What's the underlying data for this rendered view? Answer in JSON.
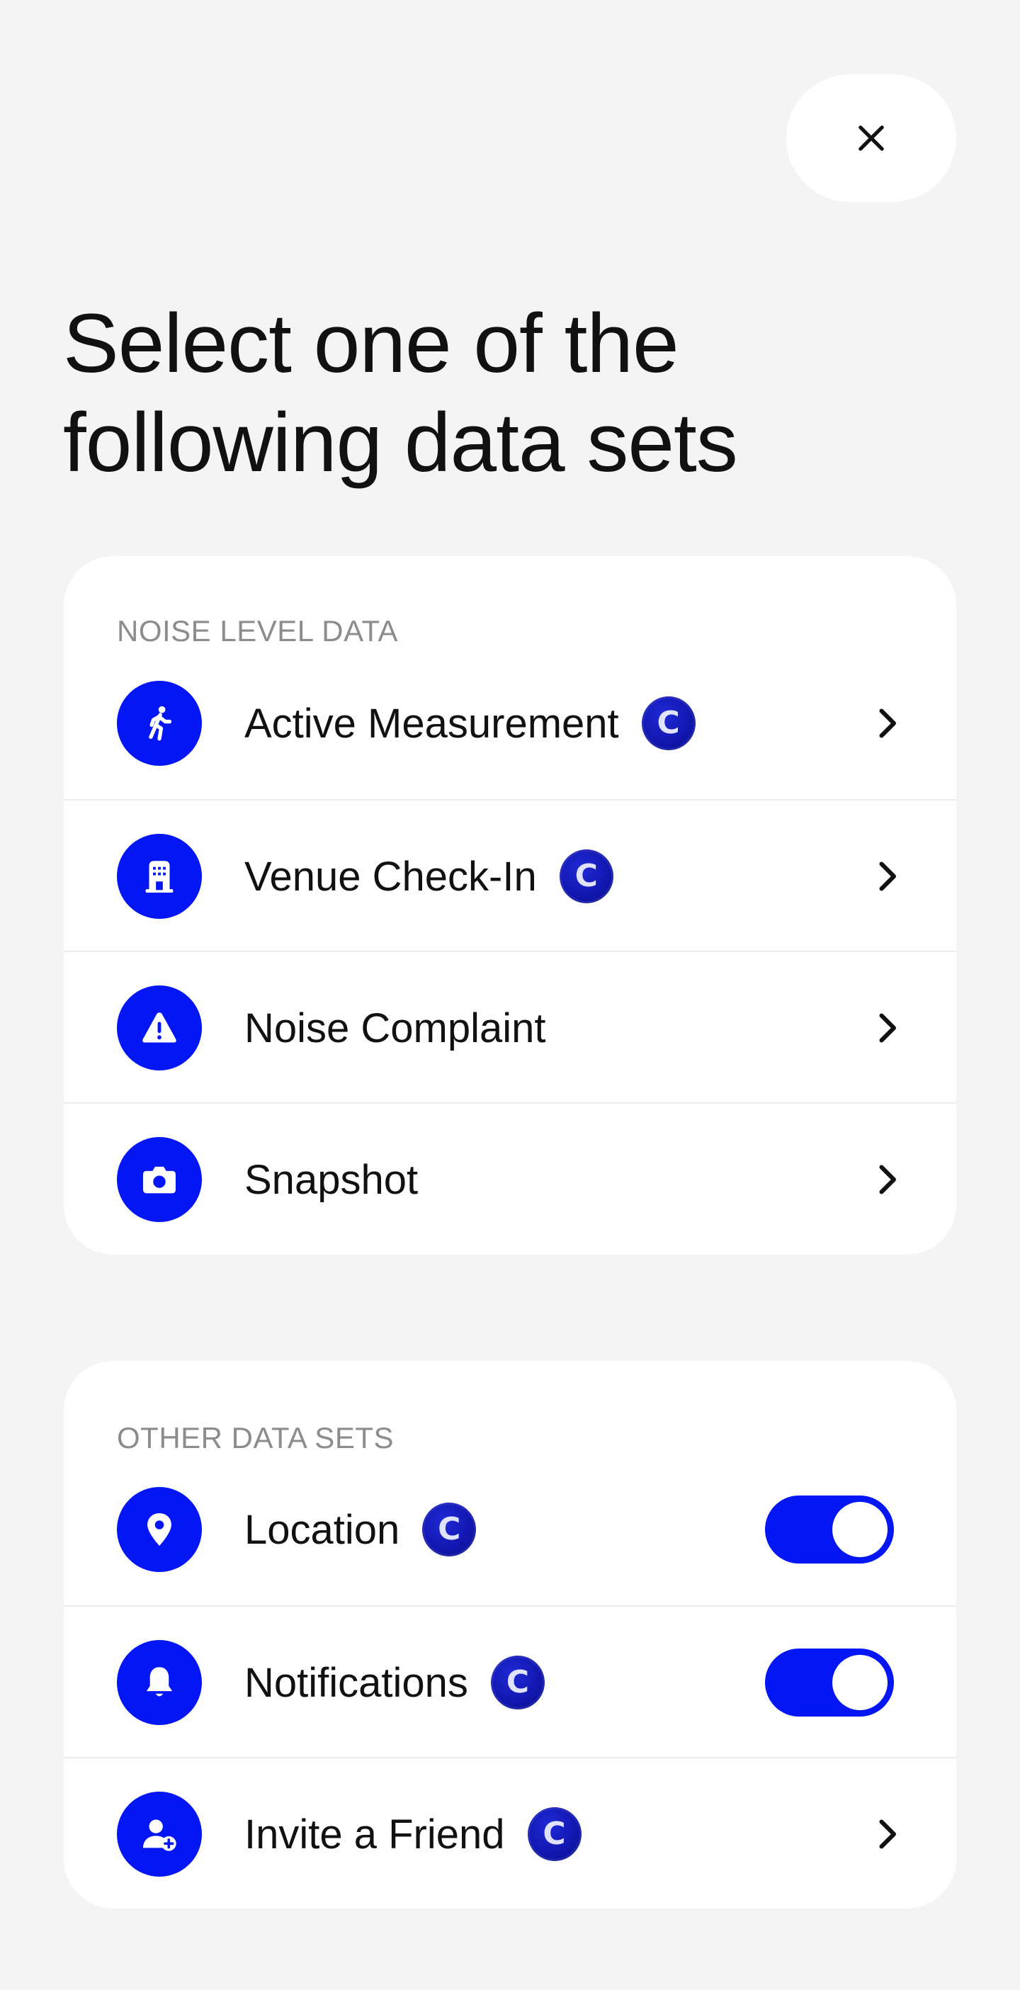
{
  "close": {
    "icon": "close-icon"
  },
  "title": {
    "line1": "Select one of the",
    "line2": "following data sets"
  },
  "noise_section": {
    "label": "NOISE LEVEL DATA",
    "items": [
      {
        "label": "Active Measurement",
        "icon": "walking-person-icon",
        "badge": "C",
        "control": "chevron"
      },
      {
        "label": "Venue Check-In",
        "icon": "building-icon",
        "badge": "C",
        "control": "chevron"
      },
      {
        "label": "Noise Complaint",
        "icon": "warning-triangle-icon",
        "control": "chevron"
      },
      {
        "label": "Snapshot",
        "icon": "camera-icon",
        "control": "chevron"
      }
    ]
  },
  "other_section": {
    "label": "OTHER DATA SETS",
    "items": [
      {
        "label": "Location",
        "icon": "location-pin-icon",
        "badge": "C",
        "control": "toggle",
        "on": true
      },
      {
        "label": "Notifications",
        "icon": "bell-icon",
        "badge": "C",
        "control": "toggle",
        "on": true
      },
      {
        "label": "Invite a Friend",
        "icon": "add-user-icon",
        "badge": "C",
        "control": "chevron"
      }
    ]
  },
  "colors": {
    "accent": "#0516f5",
    "coin": "#1217b0",
    "background": "#f4f4f4",
    "card": "#ffffff",
    "section_label": "#8c8c8c"
  }
}
